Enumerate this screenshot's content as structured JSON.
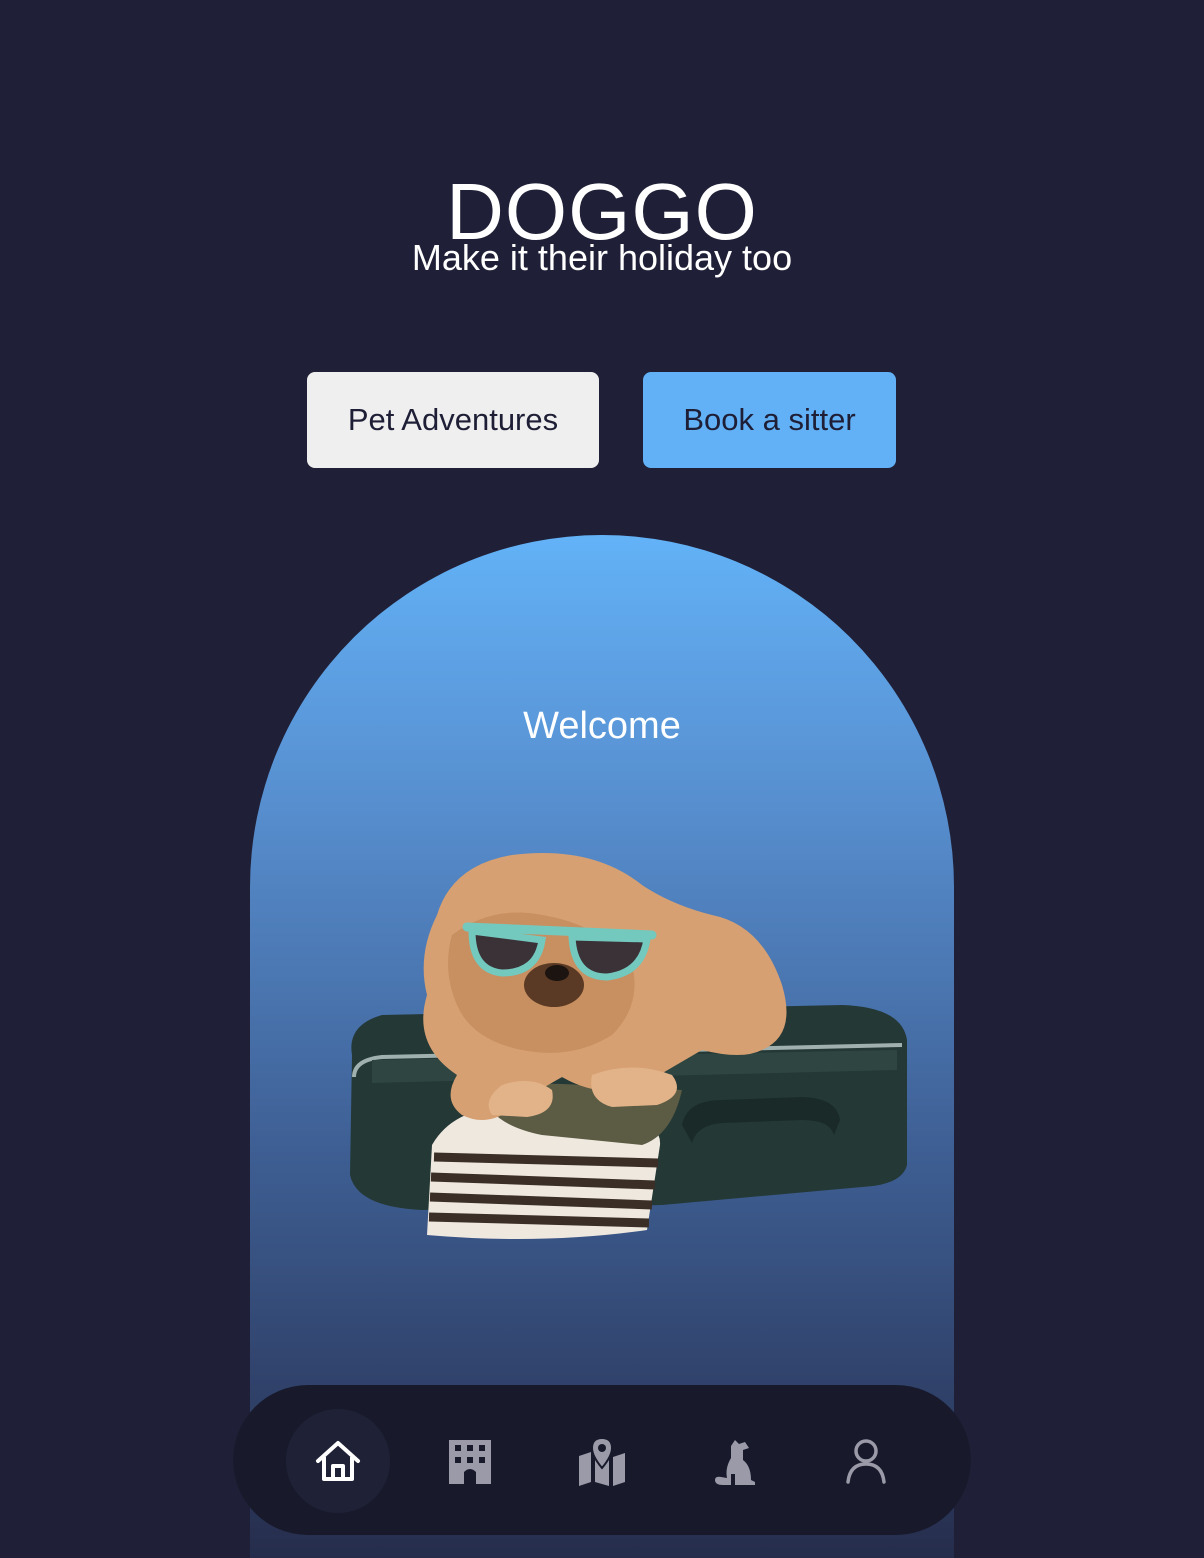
{
  "header": {
    "title": "DOGGO",
    "tagline": "Make it their holiday too"
  },
  "actions": {
    "adventures_label": "Pet Adventures",
    "sitter_label": "Book a sitter"
  },
  "hero": {
    "welcome_text": "Welcome",
    "image_subject": "dog-with-sunglasses-on-suitcase"
  },
  "nav": {
    "items": [
      {
        "icon": "home-icon",
        "active": true
      },
      {
        "icon": "building-icon",
        "active": false
      },
      {
        "icon": "map-icon",
        "active": false
      },
      {
        "icon": "dog-icon",
        "active": false
      },
      {
        "icon": "user-icon",
        "active": false
      }
    ]
  },
  "colors": {
    "background": "#1f2037",
    "primary_button": "#62b0f6",
    "secondary_button": "#efefef",
    "arch_top": "#63b2f7",
    "arch_bottom": "#262d4c",
    "navbar": "#181a2c",
    "inactive_icon": "#9a9aa8"
  }
}
